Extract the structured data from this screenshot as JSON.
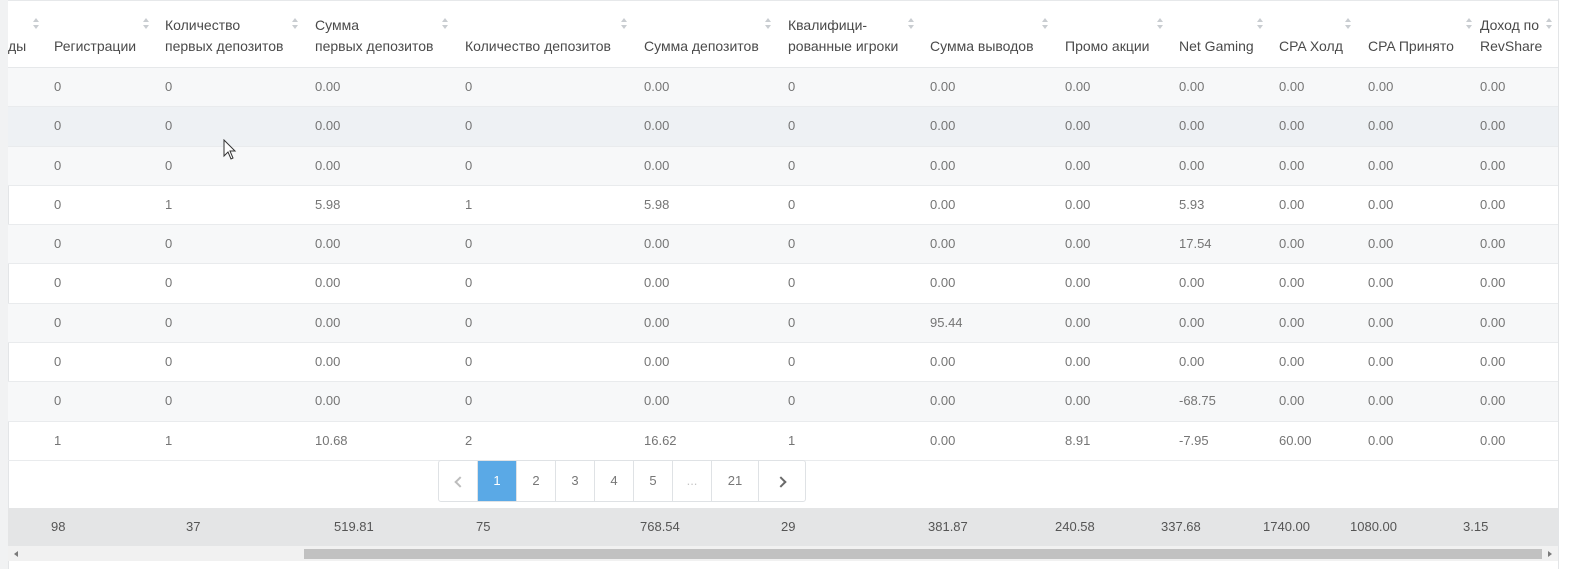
{
  "columns": [
    {
      "label_line1": "",
      "label_line2": "ды"
    },
    {
      "label_line1": "",
      "label_line2": "Регистрации"
    },
    {
      "label_line1": "Количество",
      "label_line2": "первых депозитов"
    },
    {
      "label_line1": "Сумма",
      "label_line2": "первых депозитов"
    },
    {
      "label_line1": "",
      "label_line2": "Количество депозитов"
    },
    {
      "label_line1": "",
      "label_line2": "Сумма депозитов"
    },
    {
      "label_line1": "Квалифици-",
      "label_line2": "рованные игроки"
    },
    {
      "label_line1": "",
      "label_line2": "Сумма выводов"
    },
    {
      "label_line1": "",
      "label_line2": "Промо акции"
    },
    {
      "label_line1": "",
      "label_line2": "Net Gaming"
    },
    {
      "label_line1": "",
      "label_line2": "CPA Холд"
    },
    {
      "label_line1": "",
      "label_line2": "CPA Принято"
    },
    {
      "label_line1": "Доход по",
      "label_line2": "RevShare"
    }
  ],
  "rows": [
    [
      "0",
      "0",
      "0.00",
      "0",
      "0.00",
      "0",
      "0.00",
      "0.00",
      "0.00",
      "0.00",
      "0.00",
      "0.00"
    ],
    [
      "0",
      "0",
      "0.00",
      "0",
      "0.00",
      "0",
      "0.00",
      "0.00",
      "0.00",
      "0.00",
      "0.00",
      "0.00"
    ],
    [
      "0",
      "0",
      "0.00",
      "0",
      "0.00",
      "0",
      "0.00",
      "0.00",
      "0.00",
      "0.00",
      "0.00",
      "0.00"
    ],
    [
      "0",
      "1",
      "5.98",
      "1",
      "5.98",
      "0",
      "0.00",
      "0.00",
      "5.93",
      "0.00",
      "0.00",
      "0.00"
    ],
    [
      "0",
      "0",
      "0.00",
      "0",
      "0.00",
      "0",
      "0.00",
      "0.00",
      "17.54",
      "0.00",
      "0.00",
      "0.00"
    ],
    [
      "0",
      "0",
      "0.00",
      "0",
      "0.00",
      "0",
      "0.00",
      "0.00",
      "0.00",
      "0.00",
      "0.00",
      "0.00"
    ],
    [
      "0",
      "0",
      "0.00",
      "0",
      "0.00",
      "0",
      "95.44",
      "0.00",
      "0.00",
      "0.00",
      "0.00",
      "0.00"
    ],
    [
      "0",
      "0",
      "0.00",
      "0",
      "0.00",
      "0",
      "0.00",
      "0.00",
      "0.00",
      "0.00",
      "0.00",
      "0.00"
    ],
    [
      "0",
      "0",
      "0.00",
      "0",
      "0.00",
      "0",
      "0.00",
      "0.00",
      "-68.75",
      "0.00",
      "0.00",
      "0.00"
    ],
    [
      "1",
      "1",
      "10.68",
      "2",
      "16.62",
      "1",
      "0.00",
      "8.91",
      "-7.95",
      "60.00",
      "0.00",
      "0.00"
    ]
  ],
  "pagination": {
    "pages": [
      "1",
      "2",
      "3",
      "4",
      "5",
      "...",
      "21"
    ],
    "current": "1"
  },
  "totals": [
    "98",
    "37",
    "519.81",
    "75",
    "768.54",
    "29",
    "381.87",
    "240.58",
    "337.68",
    "1740.00",
    "1080.00",
    "3.15"
  ],
  "colors": {
    "accent": "#5aa9e6",
    "totals_bg": "#e4e5e6"
  }
}
